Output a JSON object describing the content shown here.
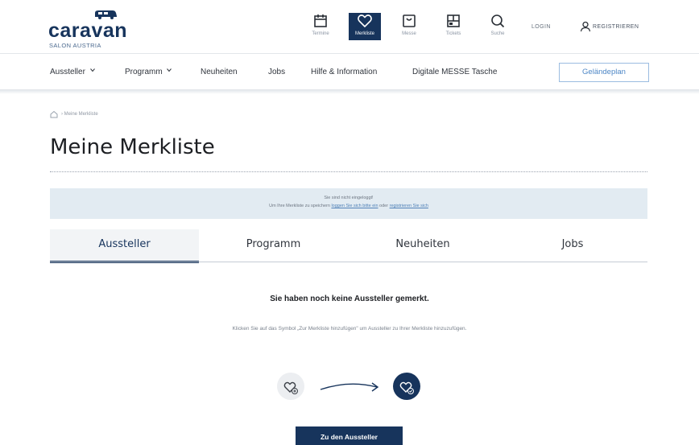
{
  "brand": {
    "logo_text": "caravan",
    "logo_subtext": "SALON AUSTRIA"
  },
  "icon_nav": {
    "items": [
      {
        "label": "Termine",
        "icon": "calendar-icon"
      },
      {
        "label": "Merkliste",
        "icon": "heart-icon",
        "active": true
      },
      {
        "label": "Messe",
        "icon": "bag-icon"
      },
      {
        "label": "Tickets",
        "icon": "ticket-icon"
      },
      {
        "label": "Suche",
        "icon": "search-icon"
      }
    ]
  },
  "account": {
    "login_label": "LOGIN",
    "register_label": "REGISTRIEREN"
  },
  "main_nav": {
    "items": [
      "Aussteller",
      "Programm",
      "Neuheiten",
      "Jobs",
      "Hilfe & Information",
      "Digitale MESSE Tasche"
    ],
    "site_plan_label": "Geländeplan"
  },
  "breadcrumb": {
    "current": "Meine Merkliste"
  },
  "page": {
    "title": "Meine Merkliste"
  },
  "notice": {
    "line1": "Sie sind nicht eingeloggt!",
    "line2_prefix": "Um Ihre Merkliste zu speichern ",
    "login_link": "loggen Sie sich bitte ein",
    "line2_middle": " oder ",
    "register_link": "registrieren Sie sich"
  },
  "tabs": [
    "Aussteller",
    "Programm",
    "Neuheiten",
    "Jobs"
  ],
  "empty_state": {
    "title": "Sie haben noch keine Aussteller gemerkt.",
    "description": "Klicken Sie auf das Symbol „Zur Merkliste hinzufügen\" um Aussteller zu Ihrer Merkliste hinzuzufügen.",
    "button_label": "Zu den Aussteller"
  },
  "colors": {
    "brand_navy": "#17345c",
    "link_blue": "#4d87c6",
    "notice_bg": "#e2ebf2"
  }
}
